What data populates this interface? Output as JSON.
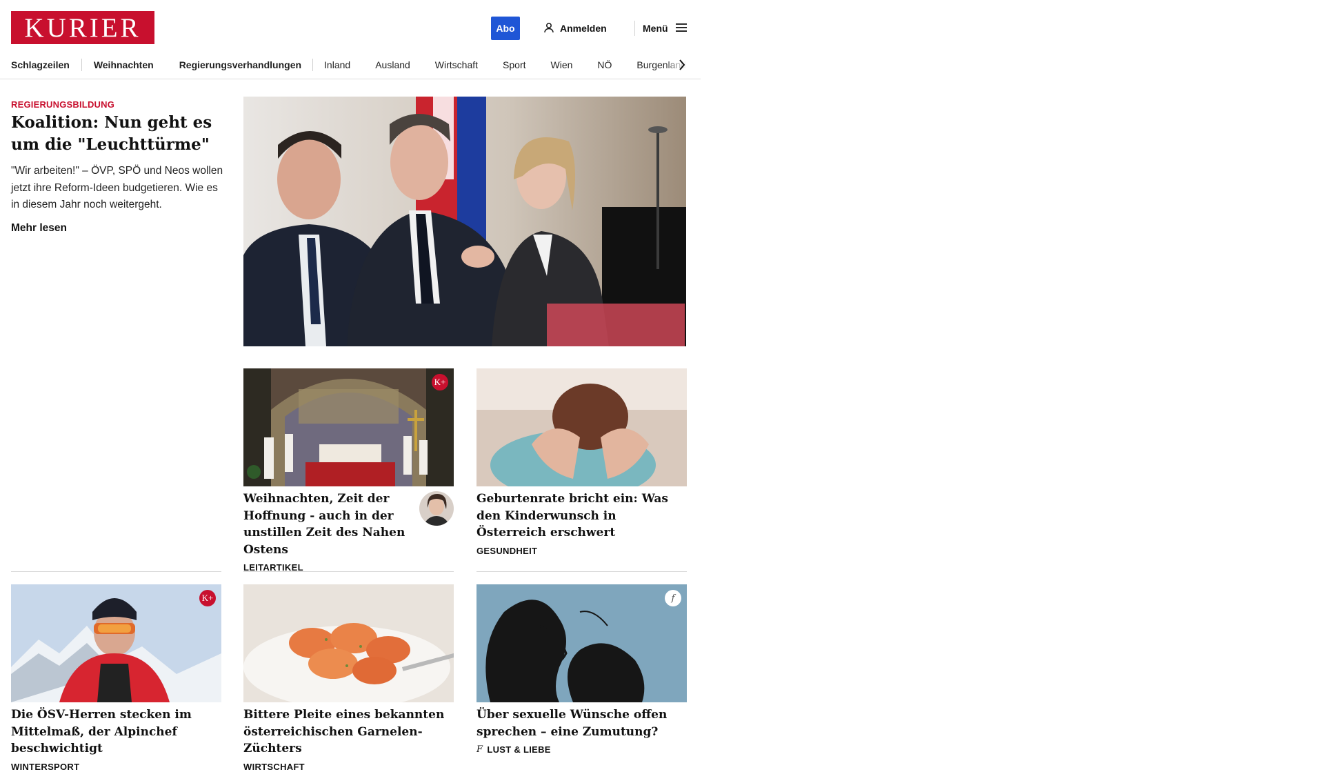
{
  "brand": {
    "logo": "KURIER",
    "accent": "#c8102e",
    "abo_color": "#1f56d6"
  },
  "header": {
    "abo": "Abo",
    "login": "Anmelden",
    "menu": "Menü"
  },
  "nav": {
    "items": [
      "Schlagzeilen",
      "Weihnachten",
      "Regierungsverhandlungen",
      "Inland",
      "Ausland",
      "Wirtschaft",
      "Sport",
      "Wien",
      "NÖ",
      "Burgenland"
    ]
  },
  "lead": {
    "kicker": "REGIERUNGSBILDUNG",
    "title": "Koalition: Nun geht es um die \"Leuchttürme\"",
    "text": "\"Wir arbeiten!\" – ÖVP, SPÖ und Neos wollen jetzt ihre Reform-Ideen budgetieren. Wie es in diesem Jahr noch weitergeht.",
    "more": "Mehr lesen"
  },
  "cards": [
    {
      "title": "Weihnachten, Zeit der Hoff­nung - auch in der unstillen Zeit des Nahen Ostens",
      "kicker": "LEITARTIKEL",
      "badge": "K+"
    },
    {
      "title": "Geburtenrate bricht ein: Was den Kinderwunsch in Österreich erschwert",
      "kicker": "GESUNDHEIT"
    },
    {
      "title": "Die ÖSV-Herren stecken im Mittel­maß, der Alpinchef beschwichtigt",
      "kicker": "WINTERSPORT",
      "badge": "K+"
    },
    {
      "title": "Bittere Pleite eines bekannten ös­terreichischen Garnelen-Züchters",
      "kicker": "WIRTSCHAFT"
    },
    {
      "title": "Über sexuelle Wünsche offen spre­chen – eine Zumutung?",
      "kicker": "LUST & LIEBE",
      "badge": "f"
    }
  ]
}
